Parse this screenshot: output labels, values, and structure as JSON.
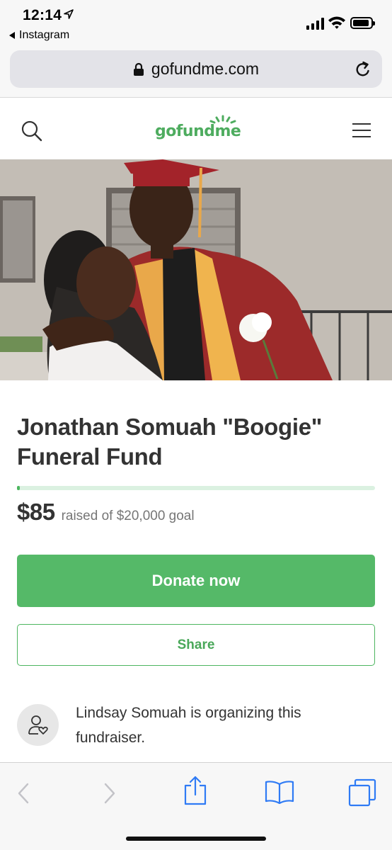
{
  "status_bar": {
    "time": "12:14",
    "back_app": "Instagram"
  },
  "browser": {
    "url": "gofundme.com",
    "icons": [
      "lock-icon",
      "reload-icon",
      "back-arrow-icon",
      "forward-arrow-icon",
      "share-icon",
      "bookmarks-icon",
      "tabs-icon"
    ]
  },
  "site_header": {
    "logo": "gofundme",
    "icons": [
      "search-icon",
      "hamburger-menu-icon"
    ]
  },
  "campaign": {
    "title": "Jonathan Somuah \"Boogie\" Funeral Fund",
    "amount_raised": "$85",
    "goal_text": "raised of $20,000 goal",
    "progress_fraction": 0.00425,
    "donate_label": "Donate now",
    "share_label": "Share",
    "organizer_text": "Lindsay Somuah is organizing this fundraiser."
  },
  "colors": {
    "brand_green": "#55b968",
    "progress_track": "#dbf1e1",
    "text": "#333333",
    "muted_text": "#767676"
  }
}
